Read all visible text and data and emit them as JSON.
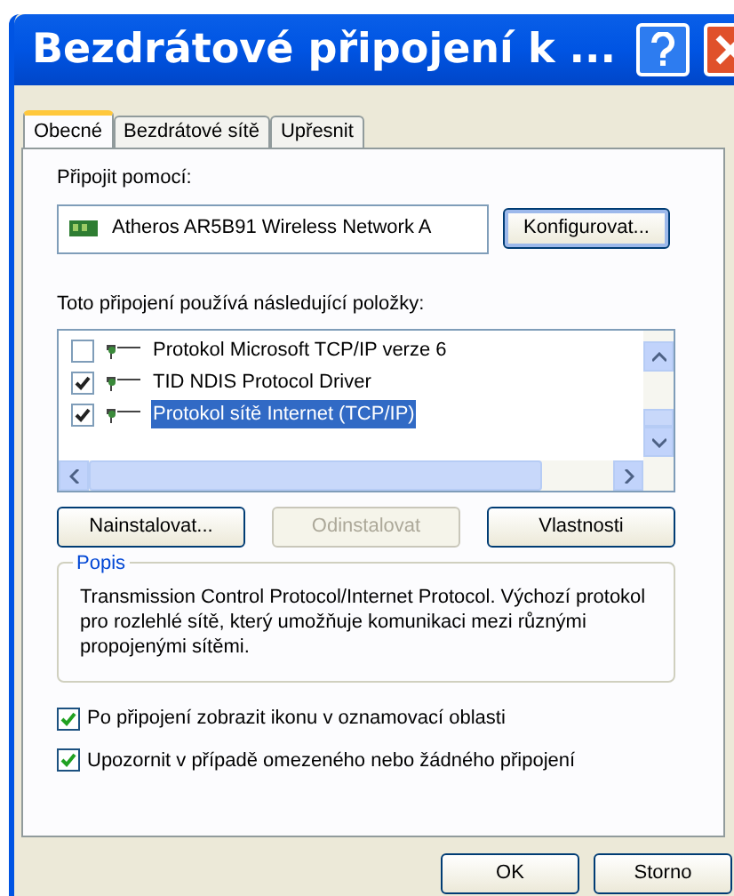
{
  "window": {
    "title": "Bezdrátové připojení k ..."
  },
  "tabs": [
    {
      "label": "Obecné",
      "selected": true
    },
    {
      "label": "Bezdrátové sítě",
      "selected": false
    },
    {
      "label": "Upřesnit",
      "selected": false
    }
  ],
  "connect_using": {
    "label": "Připojit pomocí:",
    "adapter": "Atheros AR5B91 Wireless Network A",
    "configure_button": "Konfigurovat..."
  },
  "components": {
    "label": "Toto připojení používá následující položky:",
    "items": [
      {
        "name": "Protokol Microsoft TCP/IP verze 6",
        "checked": false,
        "selected": false
      },
      {
        "name": "TID NDIS Protocol Driver",
        "checked": true,
        "selected": false
      },
      {
        "name": "Protokol sítě Internet (TCP/IP)",
        "checked": true,
        "selected": true
      }
    ]
  },
  "buttons": [
    {
      "label": "Nainstalovat...",
      "disabled": false
    },
    {
      "label": "Odinstalovat",
      "disabled": true
    },
    {
      "label": "Vlastnosti",
      "disabled": false
    }
  ],
  "description": {
    "title": "Popis",
    "text": "Transmission Control Protocol/Internet Protocol. Výchozí protokol pro rozlehlé sítě, který umožňuje komunikaci mezi různými propojenými sítěmi."
  },
  "options": [
    {
      "label": "Po připojení zobrazit ikonu v oznamovací oblasti",
      "checked": true
    },
    {
      "label": "Upozornit v případě omezeného nebo žádného připojení",
      "checked": true
    }
  ],
  "dialog_buttons": [
    "OK",
    "Storno"
  ]
}
